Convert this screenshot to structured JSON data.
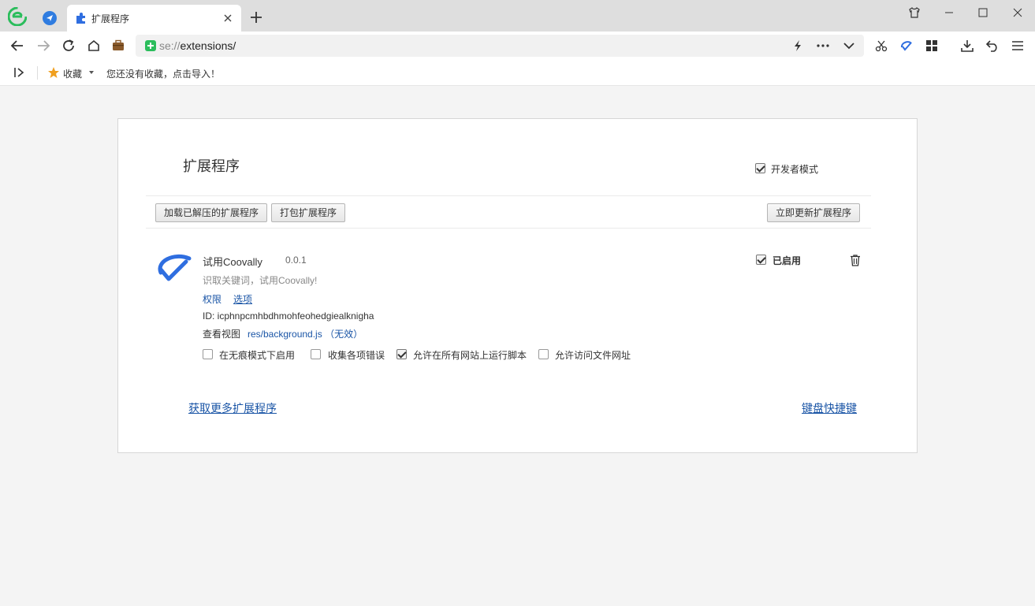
{
  "browser": {
    "tab": {
      "title": "扩展程序"
    },
    "address": {
      "scheme": "se://",
      "path": "extensions/"
    },
    "bookmarks": {
      "label": "收藏",
      "empty_text": "您还没有收藏，点击导入！"
    }
  },
  "page": {
    "title": "扩展程序",
    "developer_mode": {
      "label": "开发者模式",
      "checked": true
    },
    "buttons": {
      "load_unpacked": "加载已解压的扩展程序",
      "pack": "打包扩展程序",
      "update_now": "立即更新扩展程序"
    },
    "extension": {
      "name": "试用Coovally",
      "version": "0.0.1",
      "description": "识取关键词，试用Coovally!",
      "permissions_link": "权限",
      "options_link": "选项",
      "id_text": "ID: icphnpcmhbdhmohfeohedgiealknigha",
      "view_label": "查看视图",
      "view_link": "res/background.js",
      "view_status": "（无效）",
      "enabled_label": "已启用",
      "enabled": true,
      "options": [
        {
          "label": "在无痕模式下启用",
          "checked": false
        },
        {
          "label": "收集各项错误",
          "checked": false
        },
        {
          "label": "允许在所有网站上运行脚本",
          "checked": true
        },
        {
          "label": "允许访问文件网址",
          "checked": false
        }
      ]
    },
    "footer": {
      "more_extensions": "获取更多扩展程序",
      "shortcuts": "键盘快捷键"
    }
  },
  "colors": {
    "accent": "#1a55a6",
    "brand_green": "#2bbd5c",
    "brand_blue": "#2f6ee0"
  }
}
